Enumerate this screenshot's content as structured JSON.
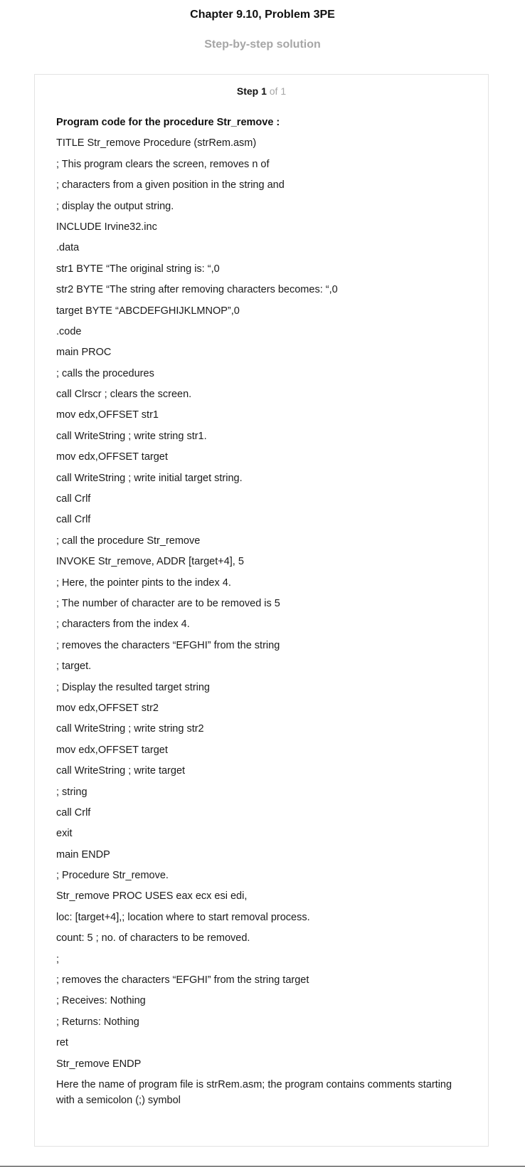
{
  "header": {
    "title": "Chapter 9.10, Problem 3PE",
    "subtitle": "Step-by-step solution"
  },
  "step": {
    "label": "Step 1",
    "of": "of 1"
  },
  "solution": {
    "heading": "Program code for the procedure Str_remove :",
    "code_lines": [
      "TITLE Str_remove Procedure (strRem.asm)",
      "; This program clears the screen, removes n of",
      "; characters from a given position in the string and",
      "; display the output string.",
      "INCLUDE Irvine32.inc",
      ".data",
      "str1 BYTE “The original string is: “,0",
      "str2 BYTE “The string after removing characters becomes: “,0",
      "target BYTE “ABCDEFGHIJKLMNOP”,0",
      ".code",
      "main PROC",
      "; calls the procedures",
      "call Clrscr ; clears the screen.",
      "mov edx,OFFSET str1",
      "call WriteString ; write string str1.",
      "mov edx,OFFSET target",
      "call WriteString ; write initial target string.",
      "call Crlf",
      "call Crlf",
      "; call the procedure Str_remove",
      "INVOKE Str_remove, ADDR [target+4], 5",
      "; Here, the pointer pints to the index 4.",
      "; The number of character are to be removed is 5",
      "; characters from the index 4.",
      "; removes the characters “EFGHI” from the string",
      "; target.",
      "; Display the resulted target string",
      "mov edx,OFFSET str2",
      "call WriteString ; write string str2",
      "mov edx,OFFSET target",
      "call WriteString ; write target",
      "; string",
      "call Crlf",
      "exit",
      "main ENDP",
      "; Procedure Str_remove.",
      "Str_remove PROC USES eax ecx esi edi,",
      "loc: [target+4],; location where to start removal process.",
      "count: 5 ; no. of characters to be removed.",
      ";",
      "; removes the characters “EFGHI” from the string target",
      "; Receives: Nothing",
      "; Returns: Nothing",
      "ret",
      "Str_remove ENDP"
    ],
    "closing_text": "Here the name of program file is strRem.asm; the program contains comments starting with a semicolon (;) symbol"
  }
}
